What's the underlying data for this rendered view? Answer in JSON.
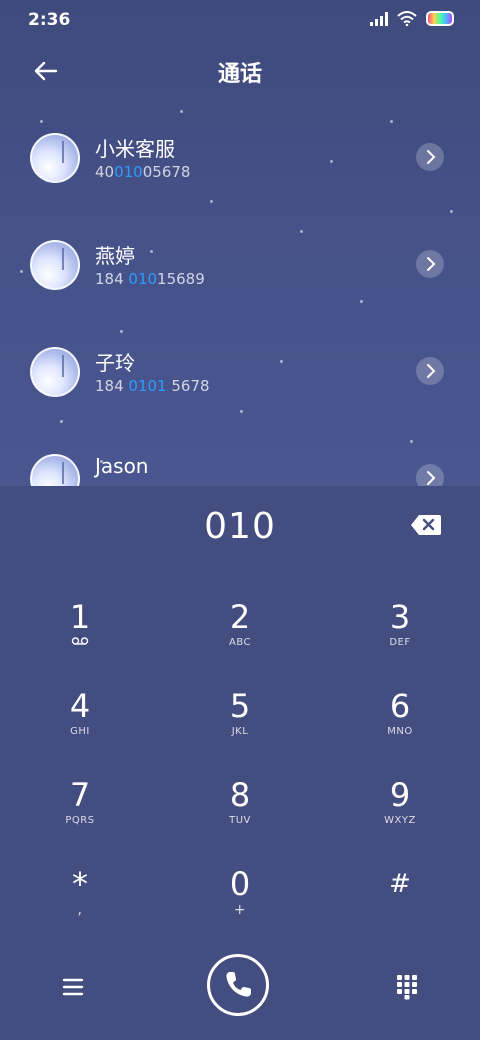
{
  "status_bar": {
    "time": "2:36",
    "icons": [
      "signal-icon",
      "wifi-icon",
      "battery-icon"
    ]
  },
  "header": {
    "title": "通话",
    "back_icon": "back-arrow-icon"
  },
  "contacts": [
    {
      "name": "小米客服",
      "number_pre": "40",
      "number_match": "010",
      "number_post": "05678"
    },
    {
      "name": "燕婷",
      "number_pre": "184 ",
      "number_match": "010",
      "number_post": "15689"
    },
    {
      "name": "子玲",
      "number_pre": "184 ",
      "number_match": "0101",
      "number_post": " 5678"
    },
    {
      "name": "Jason",
      "number_pre": "",
      "number_match": "",
      "number_post": ""
    }
  ],
  "dialer": {
    "input": "010",
    "keys": [
      {
        "digit": "1",
        "letters": ""
      },
      {
        "digit": "2",
        "letters": "ABC"
      },
      {
        "digit": "3",
        "letters": "DEF"
      },
      {
        "digit": "4",
        "letters": "GHI"
      },
      {
        "digit": "5",
        "letters": "JKL"
      },
      {
        "digit": "6",
        "letters": "MNO"
      },
      {
        "digit": "7",
        "letters": "PQRS"
      },
      {
        "digit": "8",
        "letters": "TUV"
      },
      {
        "digit": "9",
        "letters": "WXYZ"
      },
      {
        "digit": "*",
        "letters": ","
      },
      {
        "digit": "0",
        "letters": "+"
      },
      {
        "digit": "#",
        "letters": ""
      }
    ]
  },
  "colors": {
    "background": "#434d80",
    "highlight": "#2f9bff"
  }
}
